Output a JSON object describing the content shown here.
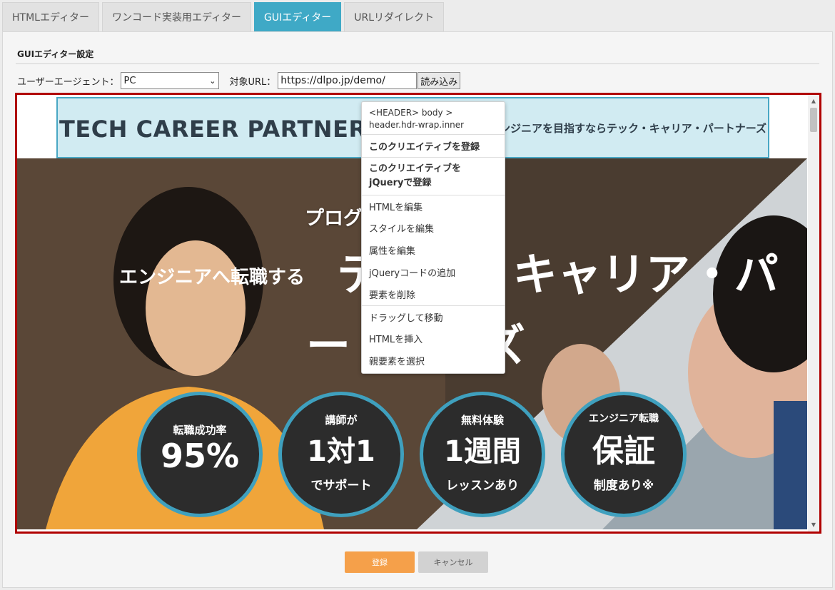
{
  "tabs": [
    {
      "label": "HTMLエディター"
    },
    {
      "label": "ワンコード実装用エディター"
    },
    {
      "label": "GUIエディター"
    },
    {
      "label": "URLリダイレクト"
    }
  ],
  "settings": {
    "title": "GUIエディター設定",
    "ua_label": "ユーザーエージェント：",
    "ua_value": "PC",
    "url_label": "対象URL：",
    "url_value": "https://dlpo.jp/demo/",
    "load_button": "読み込み"
  },
  "site": {
    "logo": "TECH CAREER PARTNERS",
    "tagline": "エンジニアを目指すならテック・キャリア・パートナーズ",
    "hero_lead": "プログラミングを学び",
    "hero_sub": "エンジニアへ転職する",
    "hero_brand_line1": "テック・キャリア・パ",
    "hero_brand_line2": "ートナーズ",
    "badges": [
      {
        "top": "転職成功率",
        "main": "95%",
        "bottom": ""
      },
      {
        "top": "講師が",
        "main": "1対1",
        "bottom": "でサポート"
      },
      {
        "top": "無料体験",
        "main": "1週間",
        "bottom": "レッスンあり"
      },
      {
        "top": "エンジニア転職",
        "main": "保証",
        "bottom": "制度あり※"
      }
    ]
  },
  "context_menu": {
    "path_line1": "<HEADER> body >",
    "path_line2": "header.hdr-wrap.inner",
    "items": {
      "register_creative": "このクリエイティブを登録",
      "register_jquery": "このクリエイティブを jQueryで登録",
      "edit_html": "HTMLを編集",
      "edit_style": "スタイルを編集",
      "edit_attr": "属性を編集",
      "add_jquery": "jQueryコードの追加",
      "delete": "要素を削除",
      "drag_move": "ドラッグして移動",
      "insert_html": "HTMLを挿入",
      "select_parent": "親要素を選択"
    }
  },
  "footer": {
    "save": "登録",
    "cancel": "キャンセル"
  },
  "colors": {
    "tab_active": "#3fa9c6",
    "frame_border": "#b00000",
    "primary_button": "#f5a04a",
    "header_highlight": "#d1ebf2"
  }
}
